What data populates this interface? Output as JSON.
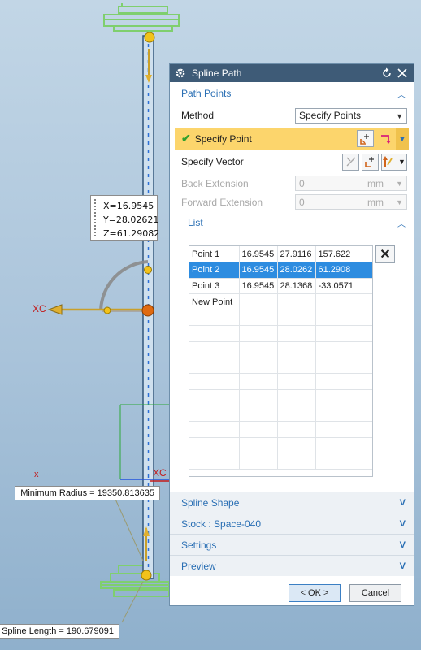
{
  "viewport": {
    "coord_readout": {
      "x": "X=16.9545",
      "y": "Y=28.02621",
      "z": "Z=61.29082"
    },
    "xc_label": "XC",
    "xc_label_2": "XC",
    "x_small_label": "x",
    "min_radius_label": "Minimum Radius = 19350.813635",
    "spline_length_label": "Spline Length = 190.679091"
  },
  "dialog": {
    "title": "Spline Path",
    "path_points": {
      "header": "Path Points",
      "method_label": "Method",
      "method_value": "Specify Points",
      "specify_point_label": "Specify Point",
      "specify_vector_label": "Specify Vector",
      "back_extension_label": "Back Extension",
      "back_extension_value": "0",
      "back_extension_unit": "mm",
      "forward_extension_label": "Forward Extension",
      "forward_extension_value": "0",
      "forward_extension_unit": "mm"
    },
    "list": {
      "header": "List",
      "rows": [
        {
          "name": "Point 1",
          "x": "16.9545",
          "y": "27.9116",
          "z": "157.622"
        },
        {
          "name": "Point 2",
          "x": "16.9545",
          "y": "28.0262",
          "z": "61.2908"
        },
        {
          "name": "Point 3",
          "x": "16.9545",
          "y": "28.1368",
          "z": "-33.0571"
        },
        {
          "name": "New Point",
          "x": "",
          "y": "",
          "z": ""
        }
      ],
      "selected_row": "Point 2"
    },
    "sections": {
      "spline_shape": "Spline Shape",
      "stock": "Stock : Space-040",
      "settings": "Settings",
      "preview": "Preview"
    },
    "ok_label": "< OK >",
    "cancel_label": "Cancel"
  },
  "colors": {
    "title_bar": "#3e5b77",
    "accent_blue": "#2a6fb4",
    "highlight_yellow": "#fcd56c",
    "selection": "#2d8ce0"
  }
}
